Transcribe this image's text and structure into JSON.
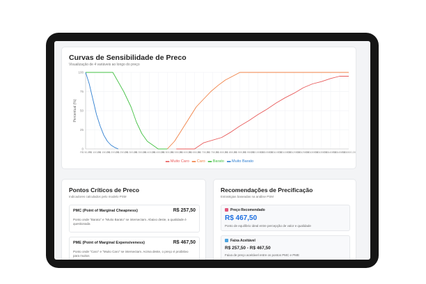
{
  "chart_panel": {
    "title": "Curvas de Sensibilidade de Preco",
    "subtitle": "Visualização de 4 variáveis ao longo do preço"
  },
  "chart_data": {
    "type": "line",
    "title": "Curvas de Sensibilidade de Preco",
    "ylabel": "Percentual (%)",
    "xlabel": "",
    "ylim": [
      0,
      100
    ],
    "yticks": [
      "0",
      "25",
      "50",
      "75",
      "100"
    ],
    "xticks": [
      "R$ 50,00",
      "R$ 100,00",
      "R$ 150,00",
      "R$ 200,00",
      "R$ 250,00",
      "R$ 300,00",
      "R$ 350,00",
      "R$ 400,00",
      "R$ 450,00",
      "R$ 500,00",
      "R$ 550,00",
      "R$ 600,00",
      "R$ 650,00",
      "R$ 700,00",
      "R$ 750,00",
      "R$ 800,00",
      "R$ 850,00",
      "R$ 900,00",
      "R$ 950,00",
      "R$ 1000,00",
      "R$ 1050,00",
      "R$ 1100,00",
      "R$ 1150,00",
      "R$ 1200,00",
      "R$ 1250,00",
      "R$ 1300,00",
      "R$ 1350,00",
      "R$ 1400,00",
      "R$ 1450,00",
      "R$ 1500,00"
    ],
    "grid": true,
    "legend_position": "bottom",
    "series": [
      {
        "name": "Muito Caro",
        "color": "#e85a5a",
        "x": [
          550,
          650,
          700,
          800,
          850,
          900,
          950,
          1000,
          1050,
          1100,
          1150,
          1200,
          1250,
          1300,
          1350,
          1400,
          1450,
          1500
        ],
        "y": [
          0,
          0,
          8,
          15,
          22,
          30,
          37,
          45,
          52,
          60,
          67,
          73,
          80,
          85,
          88,
          92,
          95,
          95
        ]
      },
      {
        "name": "Caro",
        "color": "#f08044",
        "x": [
          500,
          540,
          580,
          620,
          660,
          700,
          740,
          780,
          820,
          860,
          900,
          950,
          1000,
          1500
        ],
        "y": [
          0,
          10,
          25,
          40,
          55,
          65,
          75,
          83,
          90,
          95,
          100,
          100,
          100,
          100
        ]
      },
      {
        "name": "Barato",
        "color": "#43c043",
        "x": [
          50,
          150,
          200,
          260,
          300,
          330,
          360,
          390,
          420,
          450,
          500
        ],
        "y": [
          100,
          100,
          100,
          75,
          55,
          35,
          20,
          10,
          5,
          0,
          0
        ]
      },
      {
        "name": "Muito Barato",
        "color": "#2f7fd1",
        "x": [
          50,
          70,
          90,
          110,
          130,
          150,
          170,
          190,
          210,
          230
        ],
        "y": [
          100,
          85,
          65,
          45,
          30,
          18,
          10,
          5,
          2,
          0
        ]
      }
    ]
  },
  "critical_points": {
    "title": "Pontos Críticos de Preco",
    "subtitle": "Indicadores calculados pelo modelo PSM",
    "items": [
      {
        "name": "PMC (Point of Marginal Cheapness)",
        "value": "R$ 257,50",
        "desc": "Ponto onde \"Barato\" e \"Muito Barato\" se intersectam. Abaixo deste, a qualidade é questionada"
      },
      {
        "name": "PME (Point of Marginal Expensiveness)",
        "value": "R$ 467,50",
        "desc": "Ponto onde \"Caro\" e \"Muito Caro\" se intersectam. Acima deste, o preço é proibitivo para muitos"
      }
    ]
  },
  "recommendations": {
    "title": "Recomendações de Precificação",
    "subtitle": "Estratégias baseadas na análise PSM",
    "recommended": {
      "label": "Preço Recomendado",
      "icon": "tag-icon",
      "value": "R$ 467,50",
      "desc": "Ponto de equilíbrio ideal entre percepção de valor e qualidade"
    },
    "range": {
      "label": "Faixa Aceitável",
      "icon": "chart-bar-icon",
      "value": "R$ 257,50 - R$ 467,50",
      "desc": "Faixa de preço aceitável entre os pontos PMC e PME"
    }
  },
  "colors": {
    "accent": "#1d6fe0",
    "bezel": "#151515"
  }
}
